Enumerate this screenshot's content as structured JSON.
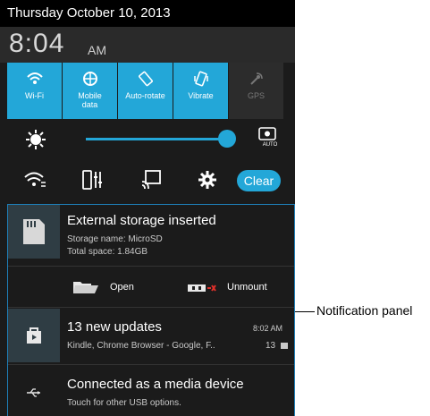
{
  "status": {
    "date": "Thursday October 10, 2013",
    "time": "8:04",
    "ampm": "AM"
  },
  "quick_settings": [
    {
      "label": "Wi-Fi",
      "icon": "wifi-icon",
      "on": true
    },
    {
      "label": "Mobile data",
      "icon": "globe-icon",
      "on": true
    },
    {
      "label": "Auto-rotate",
      "icon": "rotate-icon",
      "on": true
    },
    {
      "label": "Vibrate",
      "icon": "vibrate-icon",
      "on": true
    },
    {
      "label": "GPS",
      "icon": "gps-icon",
      "on": false
    }
  ],
  "brightness": {
    "level": 0.92,
    "auto_label": "AUTO"
  },
  "toolbar": {
    "clear_label": "Clear"
  },
  "notifications": {
    "storage": {
      "title": "External storage inserted",
      "line1": "Storage name: MicroSD",
      "line2": "Total space: 1.84GB",
      "open_label": "Open",
      "unmount_label": "Unmount"
    },
    "updates": {
      "title": "13 new updates",
      "time": "8:02 AM",
      "subtitle": "Kindle, Chrome Browser - Google, F..",
      "count": "13"
    },
    "usb": {
      "title": "Connected as a media device",
      "subtitle": "Touch for other USB options."
    }
  },
  "callout": {
    "label": "Notification panel"
  },
  "colors": {
    "accent": "#23a7d8",
    "panel_bg": "#1b1b1b",
    "border": "#1e7fb8"
  }
}
